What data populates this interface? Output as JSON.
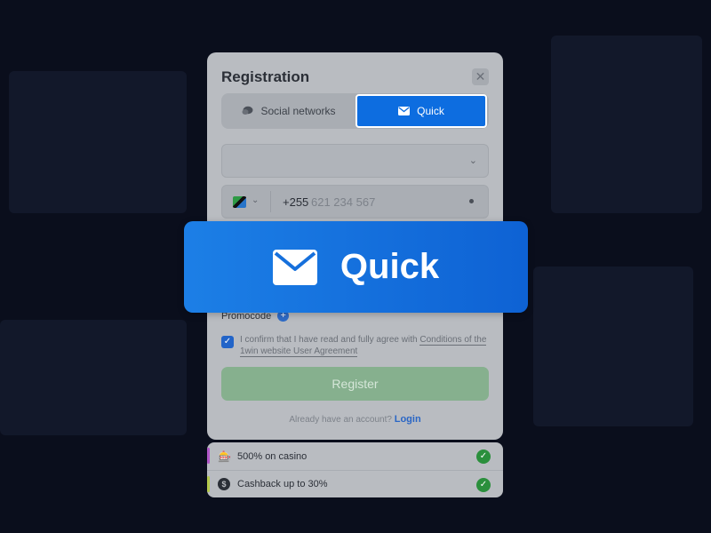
{
  "modal": {
    "title": "Registration",
    "close_glyph": "✕",
    "tabs": [
      {
        "label": "Social networks",
        "icon": "chat-icon",
        "active": false
      },
      {
        "label": "Quick",
        "icon": "envelope-icon",
        "active": true
      }
    ]
  },
  "form": {
    "currency_value": "",
    "phone_code": "+255",
    "phone_placeholder": "621 234 567",
    "promo_label": "Promocode",
    "promo_plus": "+",
    "agree_prefix": "I confirm that I have read and fully agree with ",
    "agree_link": "Conditions of the 1win website User Agreement",
    "checkbox_glyph": "✓",
    "register_label": "Register",
    "login_prompt": "Already have an account?",
    "login_link": "Login"
  },
  "bonuses": [
    {
      "label": "500% on casino",
      "icon": "casino-icon",
      "glyph": "🎰"
    },
    {
      "label": "Cashback up to 30%",
      "icon": "cashback-icon",
      "glyph": "$"
    }
  ],
  "overlay": {
    "label": "Quick",
    "icon": "envelope-icon"
  },
  "colors": {
    "accent": "#0d6de0",
    "register": "#86b08e",
    "check": "#2a8f3c"
  }
}
